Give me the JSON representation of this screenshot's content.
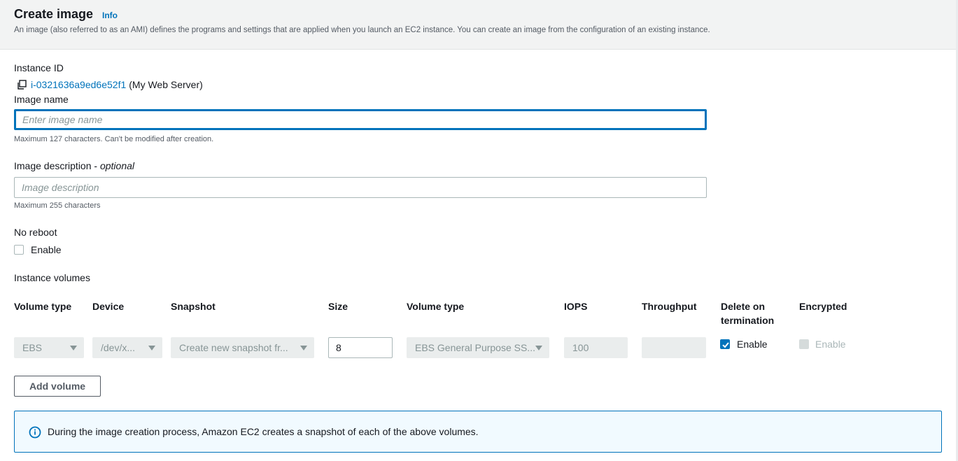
{
  "header": {
    "title": "Create image",
    "info_link": "Info",
    "description": "An image (also referred to as an AMI) defines the programs and settings that are applied when you launch an EC2 instance. You can create an image from the configuration of an existing instance."
  },
  "instance": {
    "label": "Instance ID",
    "id": "i-0321636a9ed6e52f1",
    "name": "(My Web Server)"
  },
  "image_name": {
    "label": "Image name",
    "value": "",
    "placeholder": "Enter image name",
    "hint": "Maximum 127 characters. Can't be modified after creation."
  },
  "image_description": {
    "label": "Image description",
    "label_optional": "optional",
    "value": "",
    "placeholder": "Image description",
    "hint": "Maximum 255 characters"
  },
  "no_reboot": {
    "label": "No reboot",
    "checkbox_label": "Enable",
    "checked": false
  },
  "volumes": {
    "section_label": "Instance volumes",
    "columns": [
      "Volume type",
      "Device",
      "Snapshot",
      "Size",
      "Volume type",
      "IOPS",
      "Throughput",
      "Delete on",
      "termination",
      "Encrypted"
    ],
    "row": {
      "volume_type": "EBS",
      "device": "/dev/x...",
      "snapshot": "Create new snapshot fr...",
      "size": "8",
      "ebs_volume_type": "EBS General Purpose SS...",
      "iops": "100",
      "throughput": "",
      "delete_on_termination_label": "Enable",
      "delete_on_termination": true,
      "encrypted_label": "Enable",
      "encrypted": false
    },
    "add_button": "Add volume"
  },
  "alert": {
    "text": "During the image creation process, Amazon EC2 creates a snapshot of each of the above volumes."
  },
  "colors": {
    "accent": "#0073bb",
    "header_bg": "#f2f3f3",
    "alert_bg": "#f1faff"
  },
  "icons": {
    "copy": "copy-icon",
    "info": "info-circle-icon",
    "caret": "caret-down-icon",
    "check": "check-icon"
  }
}
